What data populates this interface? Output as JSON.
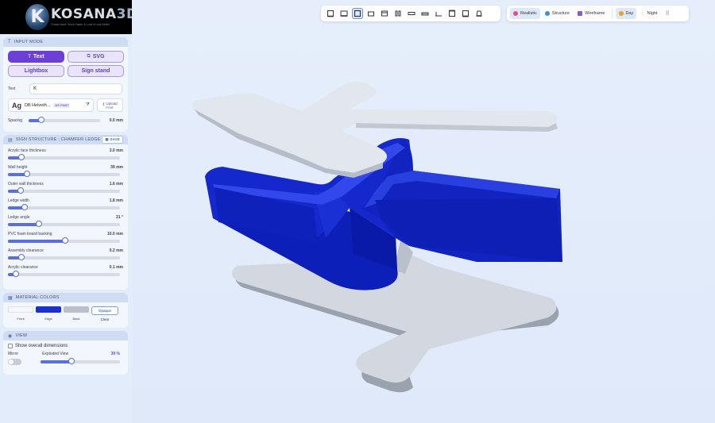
{
  "brand": {
    "logo_letter": "K",
    "name": "KOSANA",
    "name_suffix": "3D",
    "tagline": "Create More. Work Faster & Look it Look Better"
  },
  "toolbar": {
    "views": [
      {
        "icon": "view-front-icon",
        "selected": false
      },
      {
        "icon": "view-back-icon",
        "selected": false
      },
      {
        "icon": "view-top-icon",
        "selected": true
      },
      {
        "icon": "view-bottom-icon",
        "selected": false
      },
      {
        "icon": "view-left-icon",
        "selected": false
      },
      {
        "icon": "view-right-icon",
        "selected": false
      },
      {
        "icon": "view-iso-1-icon",
        "selected": false
      },
      {
        "icon": "view-iso-2-icon",
        "selected": false
      },
      {
        "icon": "view-iso-3-icon",
        "selected": false
      },
      {
        "icon": "view-iso-4-icon",
        "selected": false
      },
      {
        "icon": "view-iso-5-icon",
        "selected": false
      },
      {
        "icon": "view-iso-6-icon",
        "selected": false
      }
    ],
    "render_modes": [
      {
        "label": "Realistic",
        "color": "#e0507a"
      },
      {
        "label": "Structure",
        "color": "#3a8fd8"
      },
      {
        "label": "Wireframe",
        "color": "#8a58c8"
      }
    ],
    "lighting": [
      {
        "label": "Day",
        "color": "#f0a020"
      },
      {
        "label": "Night",
        "color": "#f0c040"
      }
    ],
    "grid_icon": "grid-icon"
  },
  "input_mode": {
    "title": "INPUT MODE",
    "buttons": [
      {
        "label": "Text",
        "glyph": "T",
        "active": true
      },
      {
        "label": "SVG",
        "glyph": "⧉",
        "active": false
      },
      {
        "label": "Lightbox",
        "glyph": "",
        "active": false
      },
      {
        "label": "Sign stand",
        "glyph": "",
        "active": false
      }
    ],
    "text_label": "Text",
    "text_value": "K",
    "font_preview": "Ag",
    "font_name": "DB Helveth...",
    "font_badge": "MY FONT",
    "upload_label_1": "Upload",
    "upload_label_2": "Font",
    "spacing_label": "Spacing",
    "spacing_value": "0.0 mm",
    "spacing_fraction": 0.18
  },
  "sign_structure": {
    "title": "SIGN STRUCTURE : CHAMFER LEDGE",
    "save_label": "SAVE",
    "fields": [
      {
        "label": "Acrylic face thickness",
        "value": "3.0 mm",
        "fraction": 0.12
      },
      {
        "label": "Wall height",
        "value": "39 mm",
        "fraction": 0.17
      },
      {
        "label": "Outer wall thickness",
        "value": "1.6 mm",
        "fraction": 0.11
      },
      {
        "label": "Ledge width",
        "value": "1.8 mm",
        "fraction": 0.15
      },
      {
        "label": "Ledge angle",
        "value": "31 °",
        "fraction": 0.28
      },
      {
        "label": "PVC foam board backing",
        "value": "10.0 mm",
        "fraction": 0.51
      },
      {
        "label": "Assembly clearance",
        "value": "0.2 mm",
        "fraction": 0.12
      },
      {
        "label": "Acrylic clearance",
        "value": "0.1 mm",
        "fraction": 0.07
      }
    ]
  },
  "material_colors": {
    "title": "MATERIAL COLORS",
    "swatches": [
      {
        "label": "Front",
        "color": "#f4f6fb"
      },
      {
        "label": "Edge",
        "color": "#1a2fd0"
      },
      {
        "label": "Back",
        "color": "#b9c0cc"
      }
    ],
    "opaque_label": "Opaque",
    "clear_label": "Clear"
  },
  "view": {
    "title": "VIEW",
    "show_dims_label": "Show overall dimensions",
    "show_dims_checked": false,
    "mirror_label": "Mirror",
    "mirror_on": false,
    "exploded_label": "Exploded View",
    "exploded_value": "39 %",
    "exploded_fraction": 0.39
  },
  "scene": {
    "face_color": "#e2e6ed",
    "edge_color": "#0f22c4",
    "back_color": "#b9c0cc"
  }
}
